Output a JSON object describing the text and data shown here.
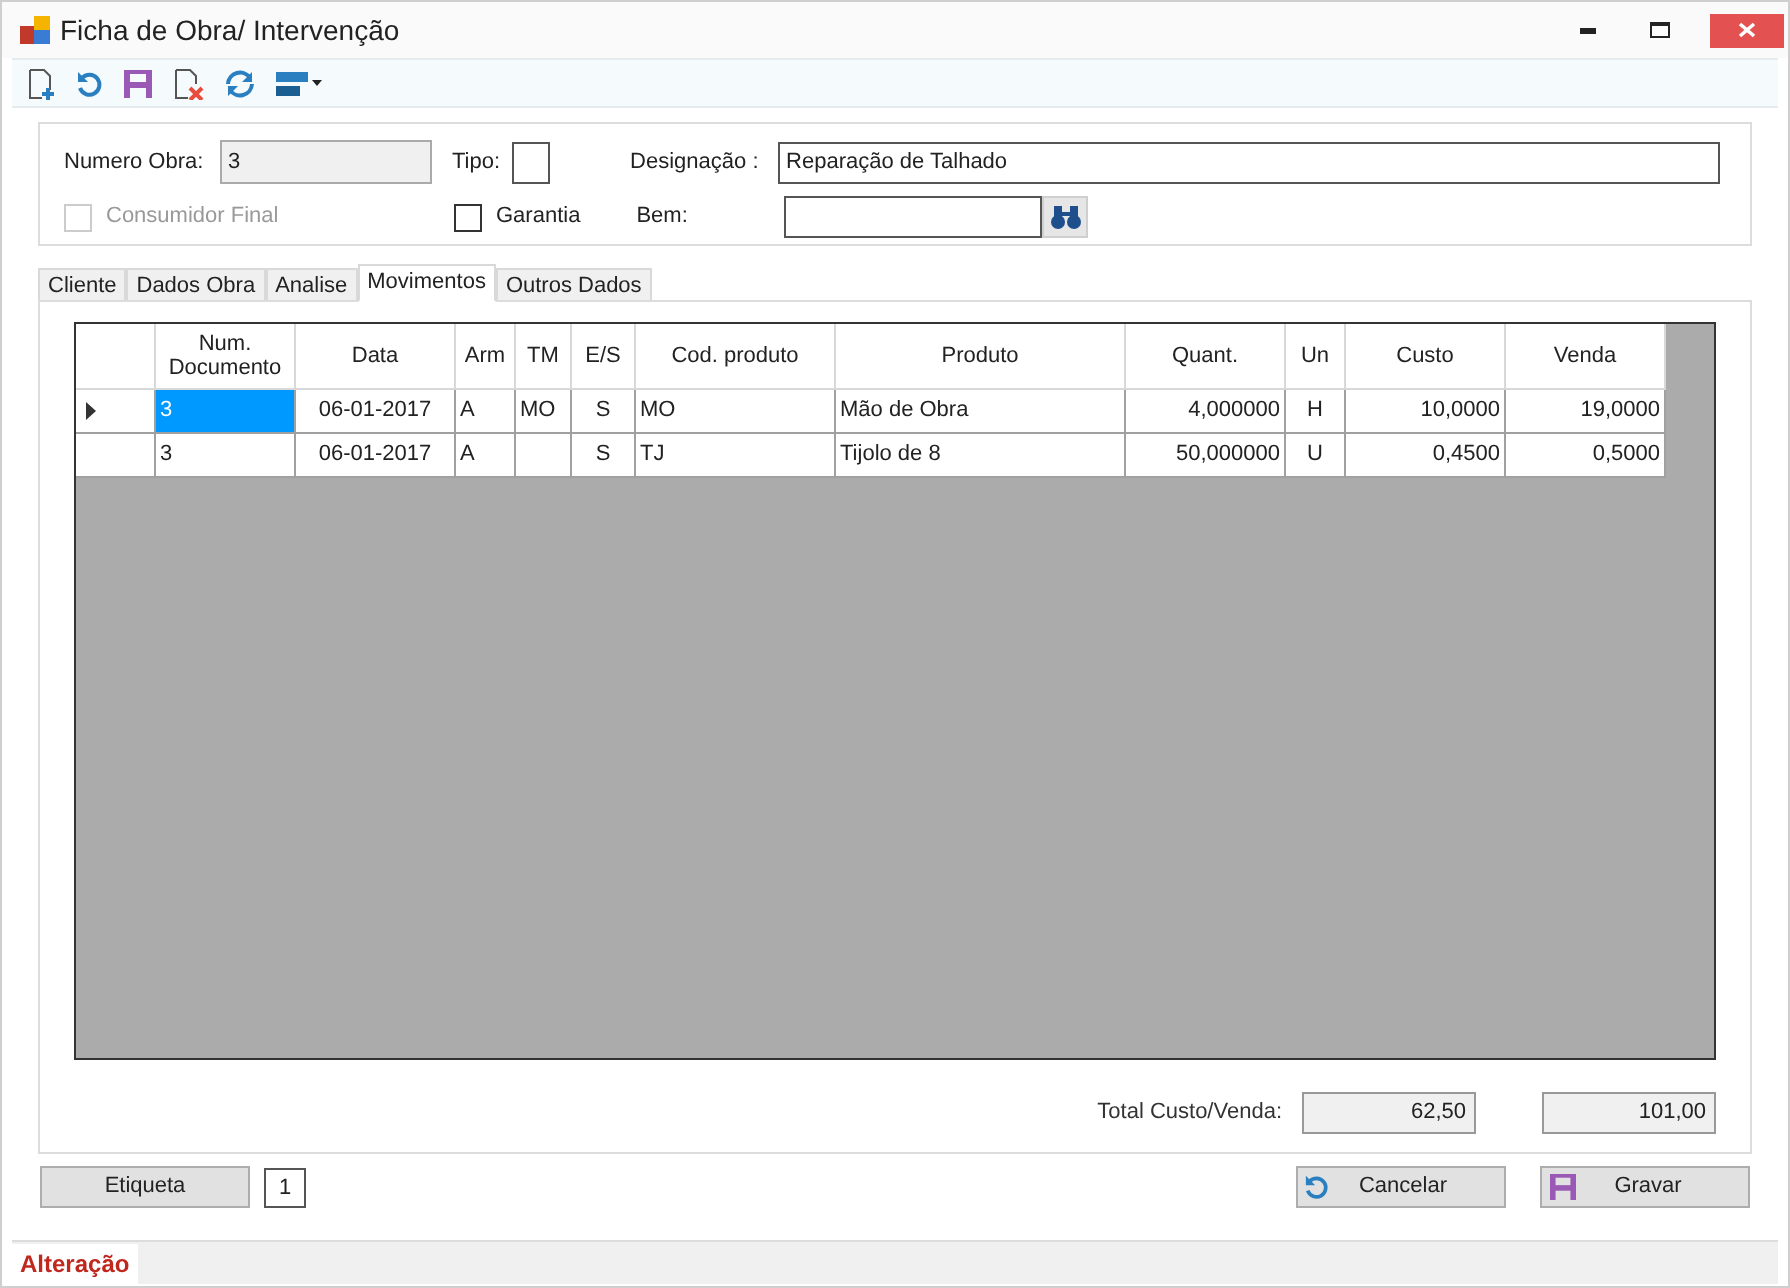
{
  "window": {
    "title": "Ficha de Obra/ Intervenção"
  },
  "form": {
    "numero_obra": {
      "label": "Numero Obra:",
      "value": "3"
    },
    "tipo": {
      "label": "Tipo:"
    },
    "designacao": {
      "label": "Designação :",
      "value": "Reparação de Talhado"
    },
    "consumidor_final": {
      "label": "Consumidor Final",
      "checked": false,
      "disabled": true
    },
    "garantia": {
      "label": "Garantia",
      "checked": false,
      "disabled": false
    },
    "bem": {
      "label": "Bem:"
    }
  },
  "tabs": [
    {
      "label": "Cliente",
      "selected": false
    },
    {
      "label": "Dados Obra",
      "selected": false
    },
    {
      "label": "Analise",
      "selected": false
    },
    {
      "label": "Movimentos",
      "selected": true
    },
    {
      "label": "Outros Dados",
      "selected": false
    }
  ],
  "table": {
    "columns": [
      "Num. Documento",
      "Data",
      "Arm",
      "TM",
      "E/S",
      "Cod. produto",
      "Produto",
      "Quant.",
      "Un",
      "Custo",
      "Venda"
    ],
    "rows": [
      {
        "current": true,
        "cells": [
          "3",
          "06-01-2017",
          "A",
          "MO",
          "S",
          "MO",
          "Mão de Obra",
          "4,000000",
          "H",
          "10,0000",
          "19,0000"
        ]
      },
      {
        "current": false,
        "cells": [
          "3",
          "06-01-2017",
          "A",
          "",
          "S",
          "TJ",
          "Tijolo de 8",
          "50,000000",
          "U",
          "0,4500",
          "0,5000"
        ]
      }
    ]
  },
  "totals": {
    "label": "Total Custo/Venda:",
    "custo": "62,50",
    "venda": "101,00"
  },
  "etiqueta": {
    "button": "Etiqueta",
    "value": "1"
  },
  "buttons": {
    "cancelar": "Cancelar",
    "gravar": "Gravar"
  },
  "status_bar": {
    "text": "Alteração"
  }
}
